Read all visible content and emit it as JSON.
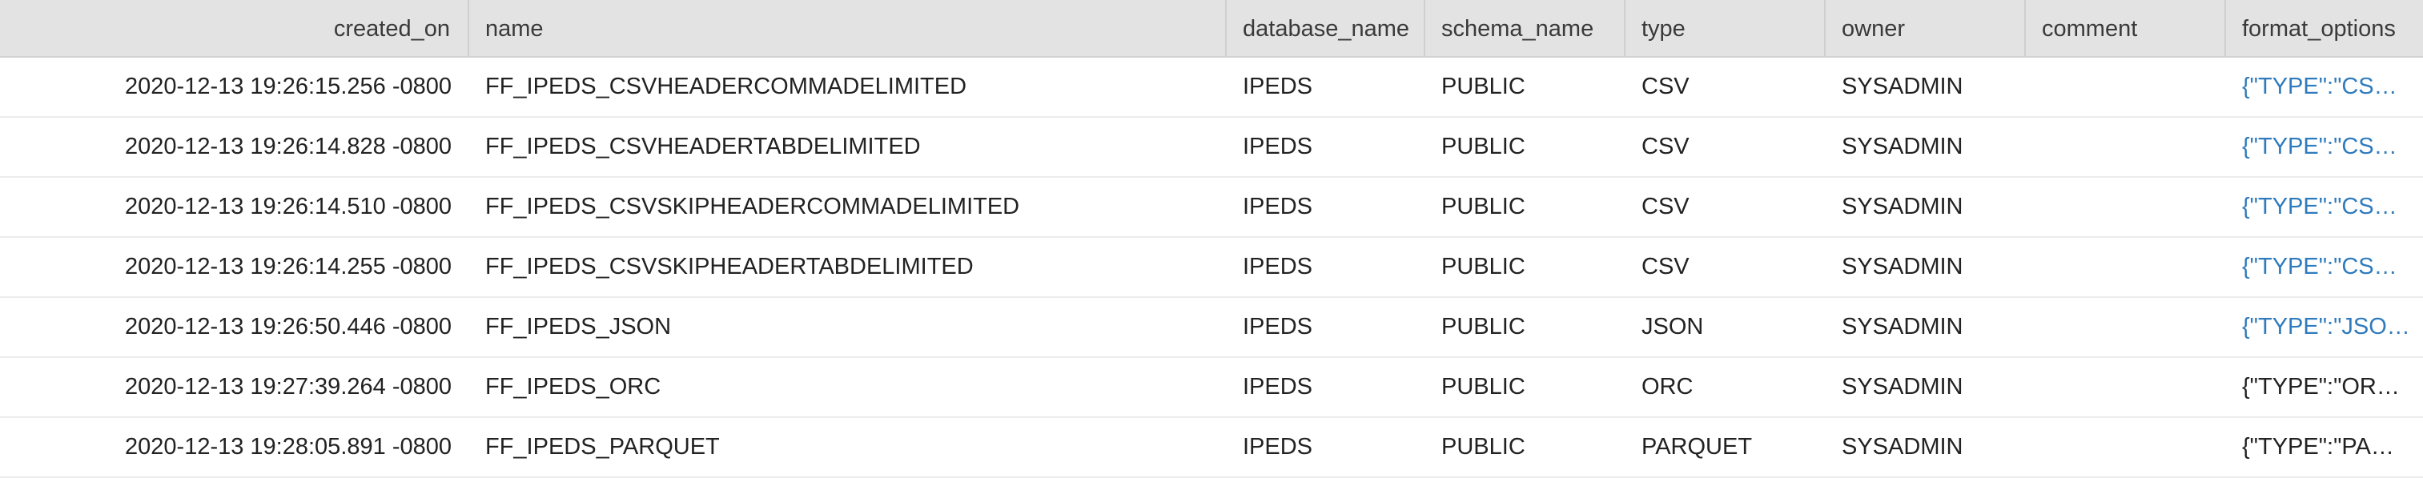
{
  "columns": {
    "created_on": "created_on",
    "name": "name",
    "database_name": "database_name",
    "schema_name": "schema_name",
    "type": "type",
    "owner": "owner",
    "comment": "comment",
    "format_options": "format_options"
  },
  "rows": [
    {
      "created_on": "2020-12-13 19:26:15.256 -0800",
      "name": "FF_IPEDS_CSVHEADERCOMMADELIMITED",
      "database_name": "IPEDS",
      "schema_name": "PUBLIC",
      "type": "CSV",
      "owner": "SYSADMIN",
      "comment": "",
      "format_options": "{\"TYPE\":\"CS…"
    },
    {
      "created_on": "2020-12-13 19:26:14.828 -0800",
      "name": "FF_IPEDS_CSVHEADERTABDELIMITED",
      "database_name": "IPEDS",
      "schema_name": "PUBLIC",
      "type": "CSV",
      "owner": "SYSADMIN",
      "comment": "",
      "format_options": "{\"TYPE\":\"CS…"
    },
    {
      "created_on": "2020-12-13 19:26:14.510 -0800",
      "name": "FF_IPEDS_CSVSKIPHEADERCOMMADELIMITED",
      "database_name": "IPEDS",
      "schema_name": "PUBLIC",
      "type": "CSV",
      "owner": "SYSADMIN",
      "comment": "",
      "format_options": "{\"TYPE\":\"CS…"
    },
    {
      "created_on": "2020-12-13 19:26:14.255 -0800",
      "name": "FF_IPEDS_CSVSKIPHEADERTABDELIMITED",
      "database_name": "IPEDS",
      "schema_name": "PUBLIC",
      "type": "CSV",
      "owner": "SYSADMIN",
      "comment": "",
      "format_options": "{\"TYPE\":\"CS…"
    },
    {
      "created_on": "2020-12-13 19:26:50.446 -0800",
      "name": "FF_IPEDS_JSON",
      "database_name": "IPEDS",
      "schema_name": "PUBLIC",
      "type": "JSON",
      "owner": "SYSADMIN",
      "comment": "",
      "format_options": "{\"TYPE\":\"JSO…"
    },
    {
      "created_on": "2020-12-13 19:27:39.264 -0800",
      "name": "FF_IPEDS_ORC",
      "database_name": "IPEDS",
      "schema_name": "PUBLIC",
      "type": "ORC",
      "owner": "SYSADMIN",
      "comment": "",
      "format_options": "{\"TYPE\":\"OR…"
    },
    {
      "created_on": "2020-12-13 19:28:05.891 -0800",
      "name": "FF_IPEDS_PARQUET",
      "database_name": "IPEDS",
      "schema_name": "PUBLIC",
      "type": "PARQUET",
      "owner": "SYSADMIN",
      "comment": "",
      "format_options": "{\"TYPE\":\"PA…"
    }
  ],
  "link_color": "#2f7bbd",
  "linked_format_rows": [
    0,
    1,
    2,
    3,
    4
  ]
}
